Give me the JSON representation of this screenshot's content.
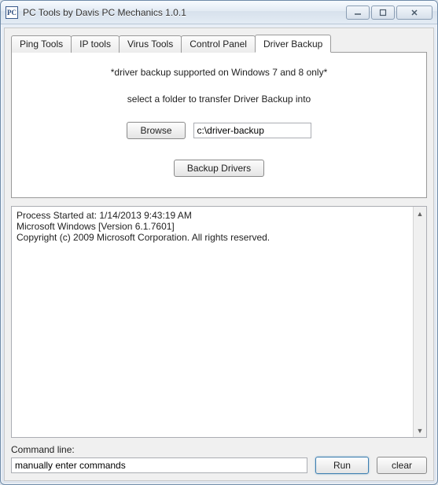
{
  "window": {
    "icon_text": "PC",
    "title": "PC Tools by Davis PC Mechanics       1.0.1"
  },
  "tabs": [
    {
      "label": "Ping Tools"
    },
    {
      "label": "IP tools"
    },
    {
      "label": "Virus Tools"
    },
    {
      "label": "Control Panel"
    },
    {
      "label": "Driver Backup"
    }
  ],
  "driver_backup": {
    "note": "*driver backup supported on Windows 7 and 8 only*",
    "instruction": "select a folder to transfer Driver Backup into",
    "browse_label": "Browse",
    "path_value": "c:\\driver-backup",
    "backup_label": "Backup Drivers"
  },
  "console": {
    "text": "Process Started at: 1/14/2013 9:43:19 AM\nMicrosoft Windows [Version 6.1.7601]\nCopyright (c) 2009 Microsoft Corporation.  All rights reserved."
  },
  "command": {
    "label": "Command line:",
    "value": "manually enter commands",
    "run_label": "Run",
    "clear_label": "clear"
  }
}
